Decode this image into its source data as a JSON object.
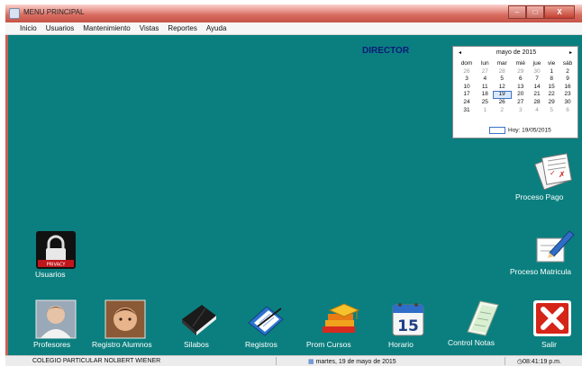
{
  "window": {
    "title": "MENU PRINCIPAL",
    "min": "–",
    "max": "□",
    "close": "X"
  },
  "menu": [
    "Inicio",
    "Usuarios",
    "Mantenimiento",
    "Vistas",
    "Reportes",
    "Ayuda"
  ],
  "role": "DIRECTOR",
  "calendar": {
    "month": "mayo de 2015",
    "prev": "◂",
    "next": "▸",
    "weekdays": [
      "dom",
      "lun",
      "mar",
      "mié",
      "jue",
      "vie",
      "sáb"
    ],
    "weeks": [
      [
        "26",
        "27",
        "28",
        "29",
        "30",
        "1",
        "2"
      ],
      [
        "3",
        "4",
        "5",
        "6",
        "7",
        "8",
        "9"
      ],
      [
        "10",
        "11",
        "12",
        "13",
        "14",
        "15",
        "16"
      ],
      [
        "17",
        "18",
        "19",
        "20",
        "21",
        "22",
        "23"
      ],
      [
        "24",
        "25",
        "26",
        "27",
        "28",
        "29",
        "30"
      ],
      [
        "31",
        "1",
        "2",
        "3",
        "4",
        "5",
        "6"
      ]
    ],
    "today": "Hoy: 19/05/2015"
  },
  "icons": {
    "proceso_pago": "Proceso Pago",
    "proceso_matricula": "Proceso Matricula",
    "usuarios": "Usuarios",
    "profesores": "Profesores",
    "registro_alumnos": "Registro Alumnos",
    "silabos": "Silabos",
    "registros": "Registros",
    "prom_cursos": "Prom Cursos",
    "horario": "Horario",
    "horario_day": "15",
    "control_notas": "Control Notas",
    "salir": "Salir",
    "privacy": "PRIVACY"
  },
  "status": {
    "school": "COLEGIO PARTICULAR NOLBERT WIENER",
    "date": "martes, 19 de mayo de 2015",
    "time": "08:41:19 p.m."
  }
}
